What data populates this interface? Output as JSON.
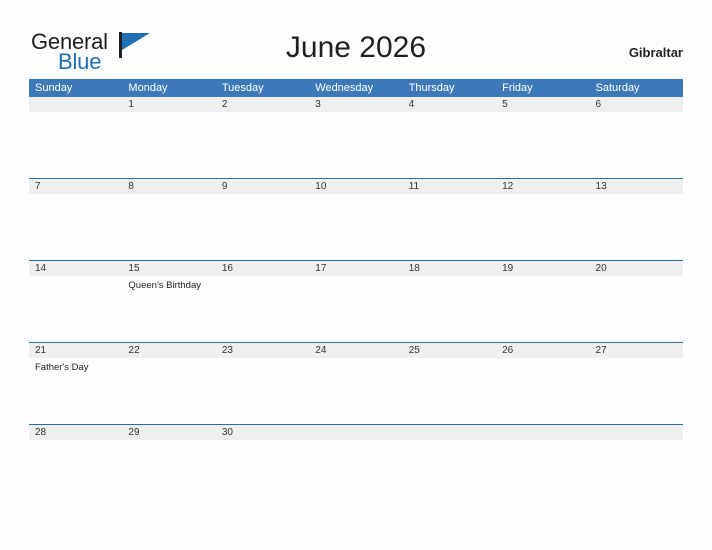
{
  "brand": {
    "word_one": "General",
    "word_two": "Blue",
    "flag_icon": "triangle-flag-icon"
  },
  "header": {
    "title": "June 2026",
    "locale": "Gibraltar"
  },
  "colors": {
    "header_blue": "#3d79b8",
    "rule_blue": "#2e6da4",
    "date_band_gray": "#efefef",
    "brand_blue": "#1f6fb5",
    "text_dark": "#231f20"
  },
  "calendar": {
    "weekdays": [
      "Sunday",
      "Monday",
      "Tuesday",
      "Wednesday",
      "Thursday",
      "Friday",
      "Saturday"
    ],
    "weeks": [
      {
        "days": [
          {
            "date": "",
            "events": []
          },
          {
            "date": "1",
            "events": []
          },
          {
            "date": "2",
            "events": []
          },
          {
            "date": "3",
            "events": []
          },
          {
            "date": "4",
            "events": []
          },
          {
            "date": "5",
            "events": []
          },
          {
            "date": "6",
            "events": []
          }
        ]
      },
      {
        "days": [
          {
            "date": "7",
            "events": []
          },
          {
            "date": "8",
            "events": []
          },
          {
            "date": "9",
            "events": []
          },
          {
            "date": "10",
            "events": []
          },
          {
            "date": "11",
            "events": []
          },
          {
            "date": "12",
            "events": []
          },
          {
            "date": "13",
            "events": []
          }
        ]
      },
      {
        "days": [
          {
            "date": "14",
            "events": []
          },
          {
            "date": "15",
            "events": [
              "Queen's Birthday"
            ]
          },
          {
            "date": "16",
            "events": []
          },
          {
            "date": "17",
            "events": []
          },
          {
            "date": "18",
            "events": []
          },
          {
            "date": "19",
            "events": []
          },
          {
            "date": "20",
            "events": []
          }
        ]
      },
      {
        "days": [
          {
            "date": "21",
            "events": [
              "Father's Day"
            ]
          },
          {
            "date": "22",
            "events": []
          },
          {
            "date": "23",
            "events": []
          },
          {
            "date": "24",
            "events": []
          },
          {
            "date": "25",
            "events": []
          },
          {
            "date": "26",
            "events": []
          },
          {
            "date": "27",
            "events": []
          }
        ]
      },
      {
        "days": [
          {
            "date": "28",
            "events": []
          },
          {
            "date": "29",
            "events": []
          },
          {
            "date": "30",
            "events": []
          },
          {
            "date": "",
            "events": []
          },
          {
            "date": "",
            "events": []
          },
          {
            "date": "",
            "events": []
          },
          {
            "date": "",
            "events": []
          }
        ]
      }
    ]
  }
}
